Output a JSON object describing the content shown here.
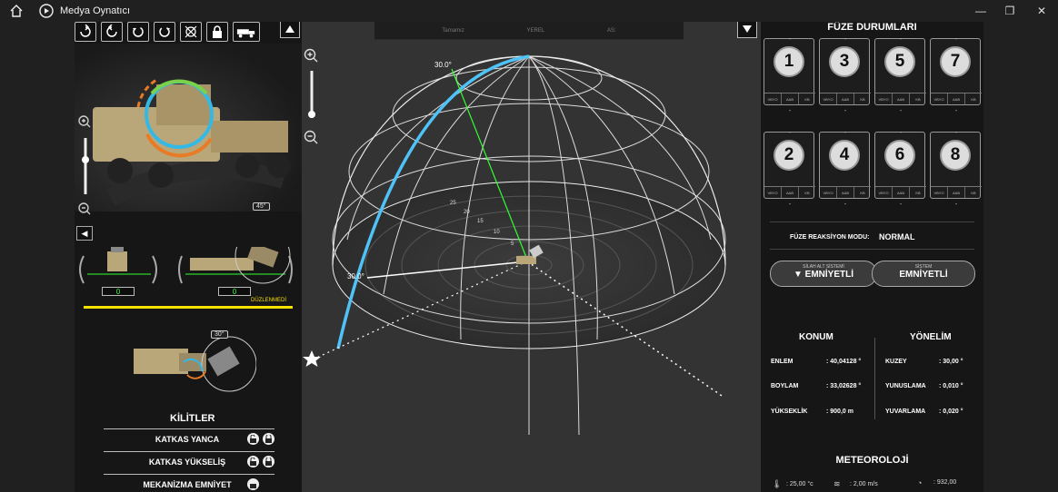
{
  "window": {
    "title": "Medya Oynatıcı",
    "min_icon": "minimize-icon",
    "max_icon": "maximize-icon",
    "close_icon": "close-icon"
  },
  "top_strip": {
    "items": [
      "Tamamız",
      "YEREL",
      "AS:"
    ]
  },
  "left_panel": {
    "toolbar_icons": [
      "rotate-cw-icon",
      "rotate-ccw-icon",
      "rotate-left-icon",
      "rotate-right-icon",
      "crosshair-icon",
      "lock-icon",
      "truck-icon"
    ],
    "angle_badge_1": "45°",
    "angle_badge_2": "30°",
    "gauge_left_value": "0",
    "gauge_right_value": "0",
    "status_label": "DÜZLENMEDİ",
    "locks_title": "KİLİTLER",
    "lock_rows": [
      {
        "label": "KATKAS YANCA"
      },
      {
        "label": "KATKAS YÜKSELİŞ"
      },
      {
        "label": "MEKANİZMA EMNİYET"
      }
    ]
  },
  "center_panel": {
    "label_top": "30.0°",
    "label_left": "30.0°",
    "ring_labels": [
      "25",
      "20",
      "15",
      "10",
      "5"
    ]
  },
  "right_panel": {
    "title": "FÜZE DURUMLARI",
    "missiles": [
      {
        "num": "1",
        "top": "-",
        "bottom": "-"
      },
      {
        "num": "3",
        "top": "-",
        "bottom": "-"
      },
      {
        "num": "5",
        "top": "-",
        "bottom": "-"
      },
      {
        "num": "7",
        "top": "-",
        "bottom": "-"
      },
      {
        "num": "2",
        "top": "-",
        "bottom": "-"
      },
      {
        "num": "4",
        "top": "-",
        "bottom": "-"
      },
      {
        "num": "6",
        "top": "-",
        "bottom": "-"
      },
      {
        "num": "8",
        "top": "-",
        "bottom": "-"
      }
    ],
    "chip_labels": [
      "VBYO",
      "AAB",
      "KB"
    ],
    "reaction_mode_label": "FÜZE REAKSİYON MODU:",
    "reaction_mode_value": "NORMAL",
    "weapon_subsystem": {
      "title": "SİLAH ALT SİSTEMİ",
      "value": "EMNİYETLİ"
    },
    "system": {
      "title": "SİSTEM",
      "value": "EMNİYETLİ"
    },
    "position_title": "KONUM",
    "orientation_title": "YÖNELİM",
    "position": [
      {
        "label": "ENLEM",
        "value": ": 40,04128 °"
      },
      {
        "label": "BOYLAM",
        "value": ": 33,02628 °"
      },
      {
        "label": "YÜKSEKLİK",
        "value": ": 900,0 m"
      }
    ],
    "orientation": [
      {
        "label": "KUZEY",
        "value": ": 30,00 °"
      },
      {
        "label": "YUNUSLAMA",
        "value": ": 0,010 °"
      },
      {
        "label": "YUVARLAMA",
        "value": ": 0,020 °"
      }
    ],
    "meteorology_title": "METEOROLOJİ",
    "meteo_values": [
      ": 25,00 °c",
      ": 2,00 m/s",
      ": 932,00"
    ]
  }
}
